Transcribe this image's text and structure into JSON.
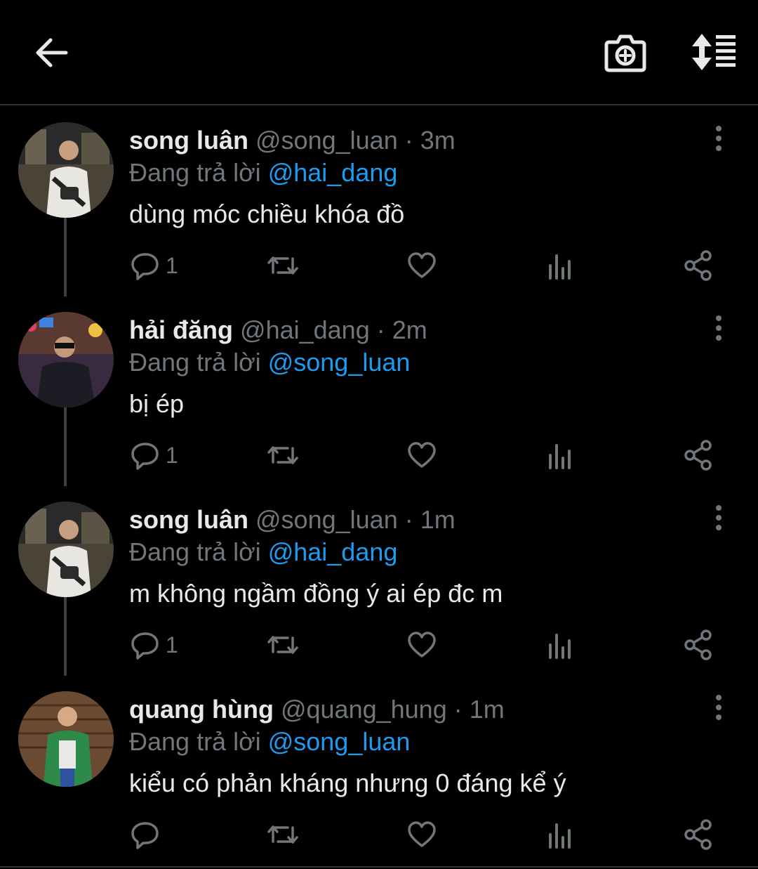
{
  "header": {
    "back_icon": "arrow-left-icon",
    "camera_icon": "camera-plus-icon",
    "sort_icon": "sort-arrows-lines-icon"
  },
  "colors": {
    "background": "#000000",
    "text": "#e7e9ea",
    "muted": "#71767b",
    "accent": "#1d9bf0",
    "divider": "#2f3336"
  },
  "tweets": [
    {
      "name": "song luân",
      "handle": "@song_luan",
      "separator": "·",
      "time": "3m",
      "reply_prefix": "Đang trả lời",
      "reply_to": "@hai_dang",
      "text": "dùng móc chiều khóa đồ",
      "reply_count": "1"
    },
    {
      "name": "hải đăng",
      "handle": "@hai_dang",
      "separator": "·",
      "time": "2m",
      "reply_prefix": "Đang trả lời",
      "reply_to": "@song_luan",
      "text": "bị ép",
      "reply_count": "1"
    },
    {
      "name": "song luân",
      "handle": "@song_luan",
      "separator": "·",
      "time": "1m",
      "reply_prefix": "Đang trả lời",
      "reply_to": "@hai_dang",
      "text": "m không ngầm đồng ý ai ép đc m",
      "reply_count": "1"
    },
    {
      "name": "quang hùng",
      "handle": "@quang_hung",
      "separator": "·",
      "time": "1m",
      "reply_prefix": "Đang trả lời",
      "reply_to": "@song_luan",
      "text": "kiểu có phản kháng nhưng 0 đáng kể ý",
      "reply_count": ""
    }
  ]
}
